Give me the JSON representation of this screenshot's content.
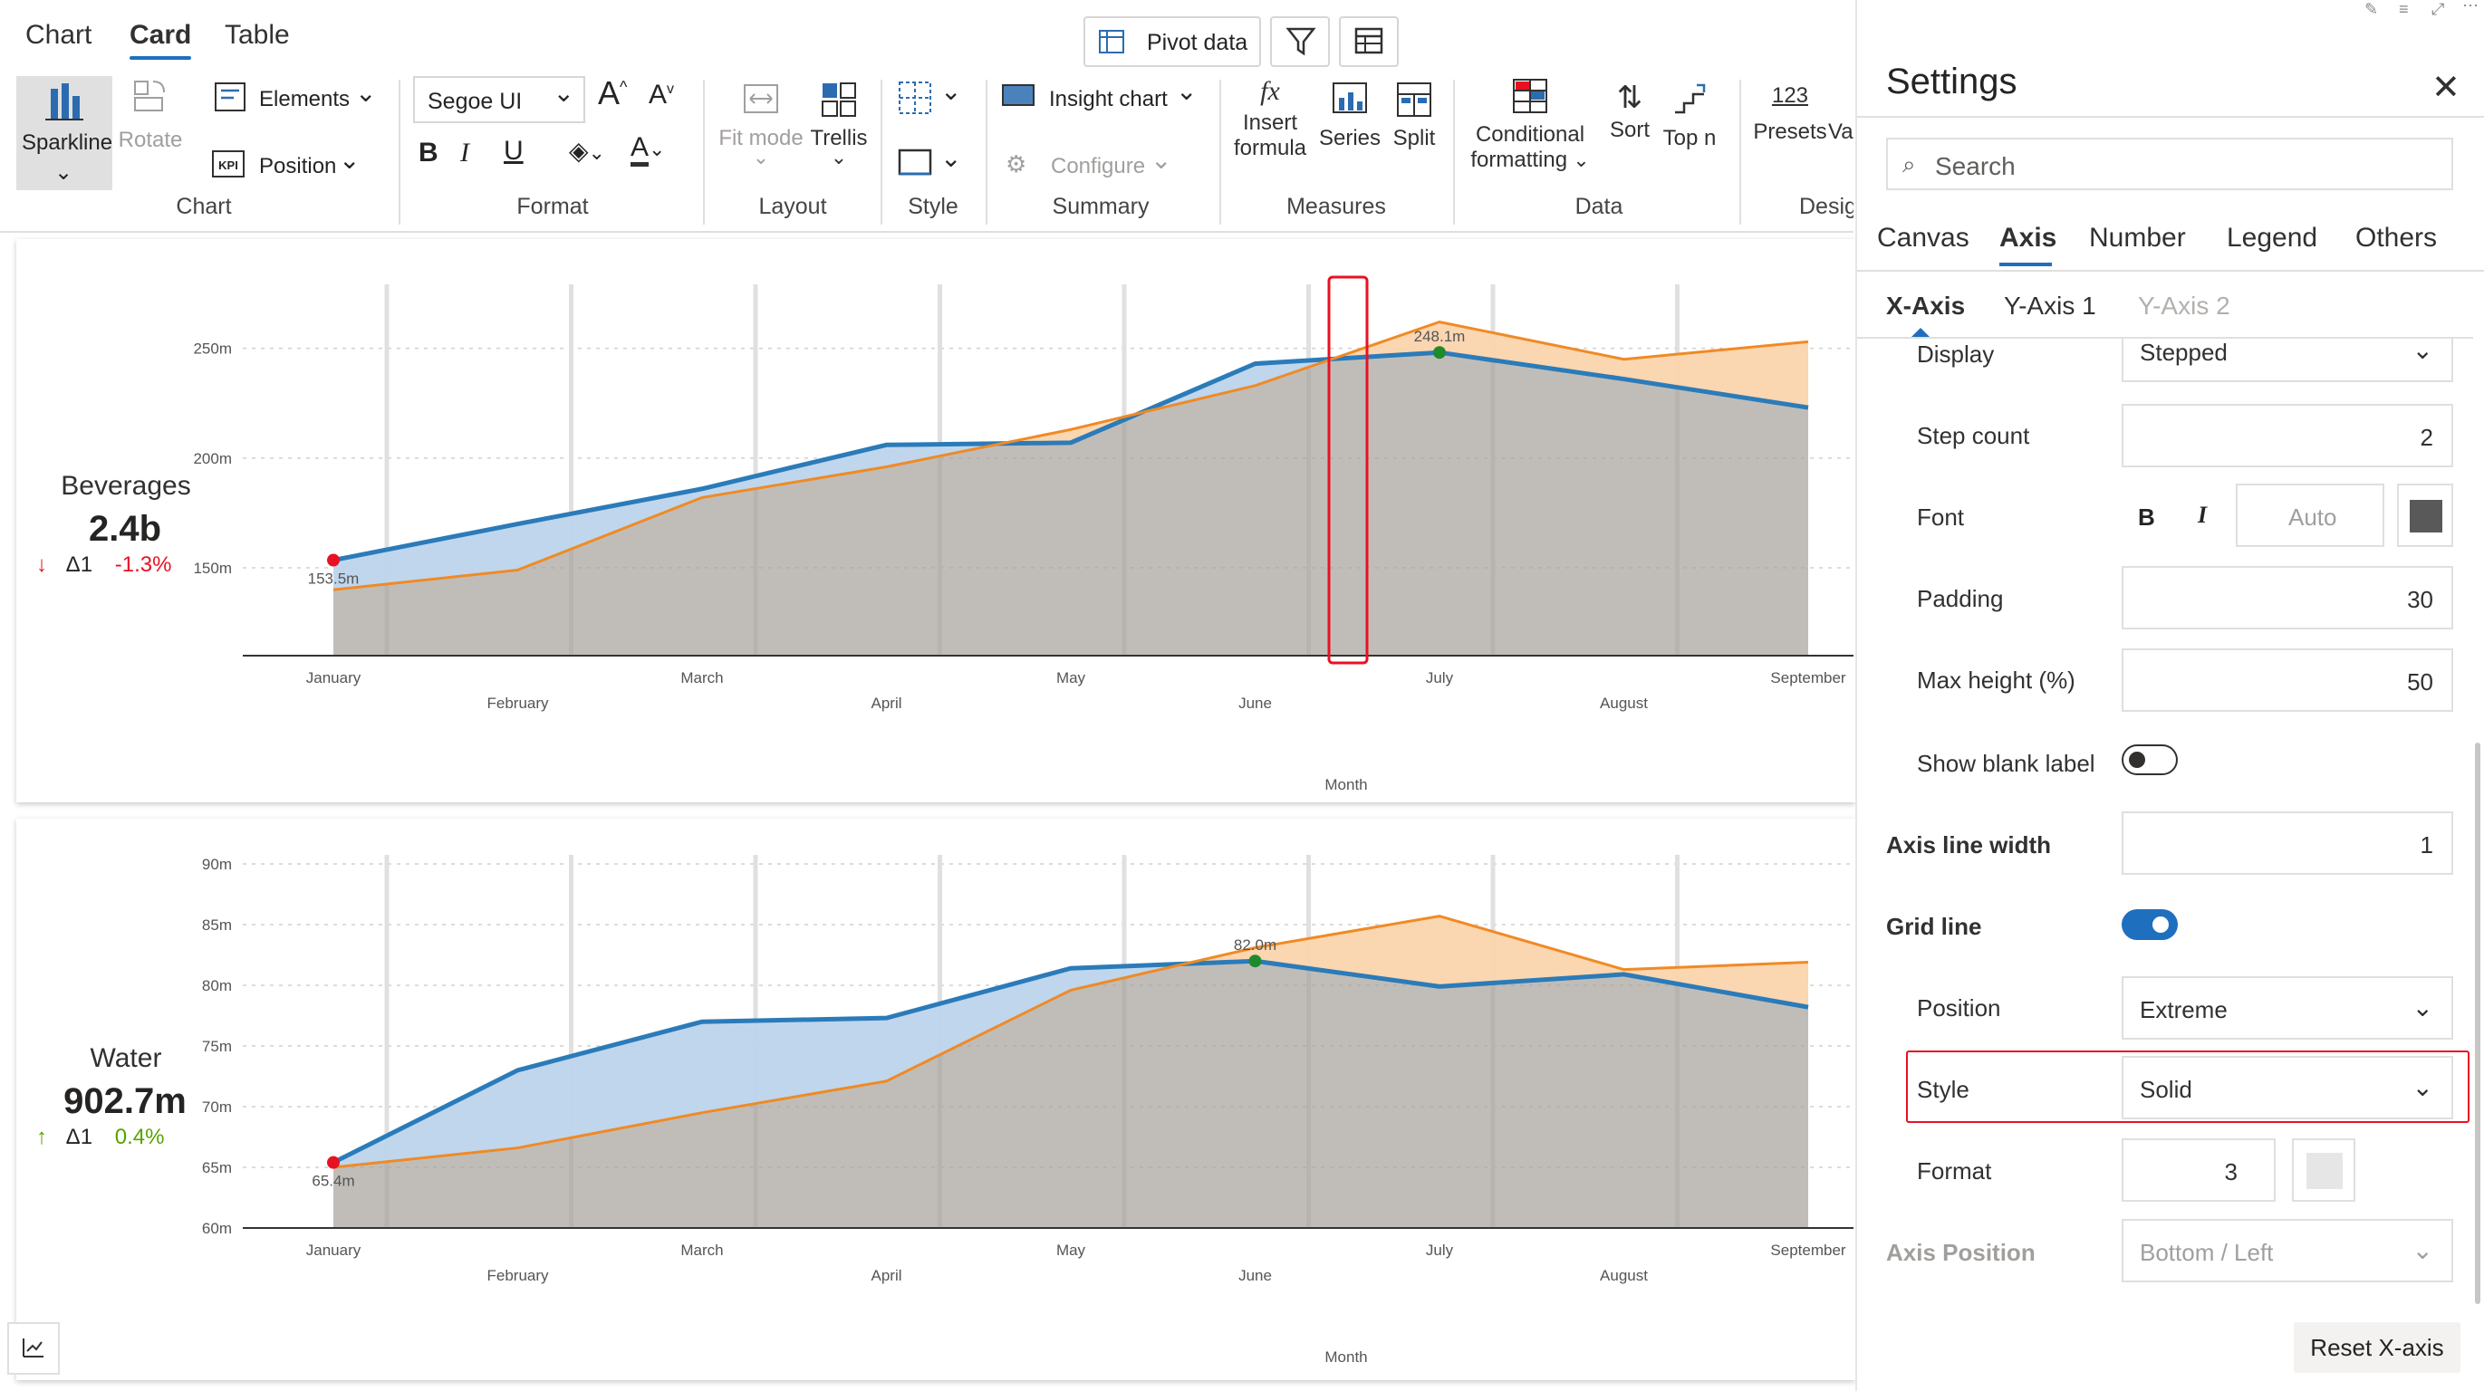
{
  "menu_tabs": [
    "Chart",
    "Card",
    "Table"
  ],
  "ribbon": {
    "pivot_data": "Pivot data",
    "sparkline": "Sparkline",
    "rotate": "Rotate",
    "elements": "Elements",
    "position": "Position",
    "font_name": "Segoe UI",
    "fit_mode": "Fit mode",
    "trellis": "Trellis",
    "insight_chart": "Insight chart",
    "configure": "Configure",
    "insert_formula_1": "Insert",
    "insert_formula_2": "formula",
    "series": "Series",
    "split": "Split",
    "cond_fmt_1": "Conditional",
    "cond_fmt_2": "formatting",
    "sort": "Sort",
    "top_n": "Top n",
    "presets_num": "123",
    "presets": "Presets",
    "va": "Va",
    "groups": {
      "chart": "Chart",
      "format": "Format",
      "layout": "Layout",
      "style": "Style",
      "summary": "Summary",
      "measures": "Measures",
      "data": "Data",
      "design": "Desig"
    }
  },
  "cards": [
    {
      "name": "Beverages",
      "value": "2.4b",
      "delta_label": "Δ1",
      "delta_pct": "-1.3%",
      "delta_color": "#e81123",
      "x_axis_title": "Month",
      "y_ticks": [
        "250m",
        "200m",
        "150m"
      ],
      "min_label": "153.5m",
      "max_label": "248.1m"
    },
    {
      "name": "Water",
      "value": "902.7m",
      "delta_label": "Δ1",
      "delta_pct": "0.4%",
      "delta_color": "#57a300",
      "x_axis_title": "Month",
      "y_ticks": [
        "90m",
        "85m",
        "80m",
        "75m",
        "70m",
        "65m",
        "60m"
      ],
      "min_label": "65.4m",
      "max_label": "82.0m"
    }
  ],
  "chart_data": [
    {
      "type": "area",
      "categories": [
        "January",
        "February",
        "March",
        "April",
        "May",
        "June",
        "July",
        "August",
        "September"
      ],
      "series": [
        {
          "values": [
            153.5,
            170,
            186,
            206,
            207,
            243,
            248.1,
            236,
            223
          ],
          "color": "#2b7bb9"
        },
        {
          "values": [
            140,
            149,
            182,
            196,
            213,
            233,
            262,
            245,
            253
          ],
          "color": "#f08a24"
        }
      ],
      "ylim": [
        110,
        275
      ],
      "xlabel": "Month"
    },
    {
      "type": "area",
      "categories": [
        "January",
        "February",
        "March",
        "April",
        "May",
        "June",
        "July",
        "August",
        "September"
      ],
      "series": [
        {
          "values": [
            65.4,
            73,
            77,
            77.3,
            81.4,
            82.0,
            79.9,
            80.9,
            78.2
          ],
          "color": "#2b7bb9"
        },
        {
          "values": [
            65,
            66.6,
            69.5,
            72.1,
            79.6,
            83.1,
            85.7,
            81.3,
            81.9
          ],
          "color": "#f08a24"
        }
      ],
      "ylim": [
        60,
        90
      ],
      "xlabel": "Month"
    }
  ],
  "settings": {
    "title": "Settings",
    "search_placeholder": "Search",
    "tabs": [
      "Canvas",
      "Axis",
      "Number",
      "Legend",
      "Others"
    ],
    "active_tab": "Axis",
    "subtabs": [
      "X-Axis",
      "Y-Axis 1",
      "Y-Axis 2"
    ],
    "rows": {
      "display_label": "Display",
      "display_value": "Stepped",
      "step_count_label": "Step count",
      "step_count_value": "2",
      "font_label": "Font",
      "font_bold": "B",
      "font_italic": "I",
      "font_size": "Auto",
      "font_color": "#595959",
      "padding_label": "Padding",
      "padding_value": "30",
      "max_height_label": "Max height (%)",
      "max_height_value": "50",
      "show_blank_label": "Show blank label",
      "axis_line_width_label": "Axis line width",
      "axis_line_width_value": "1",
      "grid_line_label": "Grid line",
      "position_label": "Position",
      "position_value": "Extreme",
      "style_label": "Style",
      "style_value": "Solid",
      "format_label": "Format",
      "format_value": "3",
      "format_color": "#e6e6e6",
      "axis_position_label": "Axis Position",
      "axis_position_value": "Bottom / Left"
    },
    "reset_button": "Reset X-axis"
  }
}
